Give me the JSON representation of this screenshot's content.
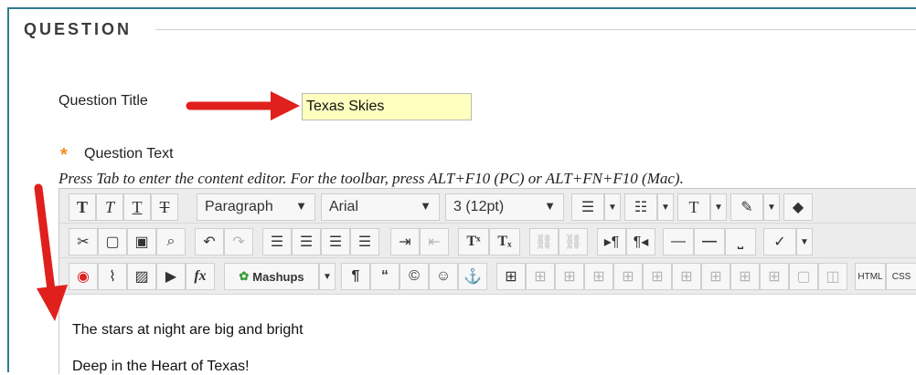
{
  "section": {
    "title": "QUESTION"
  },
  "question_title": {
    "label": "Question Title",
    "value": "Texas Skies"
  },
  "question_text": {
    "required_mark": "*",
    "label": "Question Text",
    "hint": "Press Tab to enter the content editor. For the toolbar, press ALT+F10 (PC) or ALT+FN+F10 (Mac)."
  },
  "toolbar": {
    "format_value": "Paragraph",
    "font_value": "Arial",
    "size_value": "3 (12pt)",
    "mashups_label": "Mashups",
    "html_label": "HTML",
    "css_label": "CSS",
    "dropdown_glyph": "▼"
  },
  "editor_content": {
    "line1": "The stars at night are big and bright",
    "line2": "Deep in the Heart of Texas!"
  },
  "colors": {
    "frame": "#2f7d8c",
    "arrow": "#e0201c",
    "input_bg": "#ffffc0",
    "required": "#f28c1e"
  }
}
